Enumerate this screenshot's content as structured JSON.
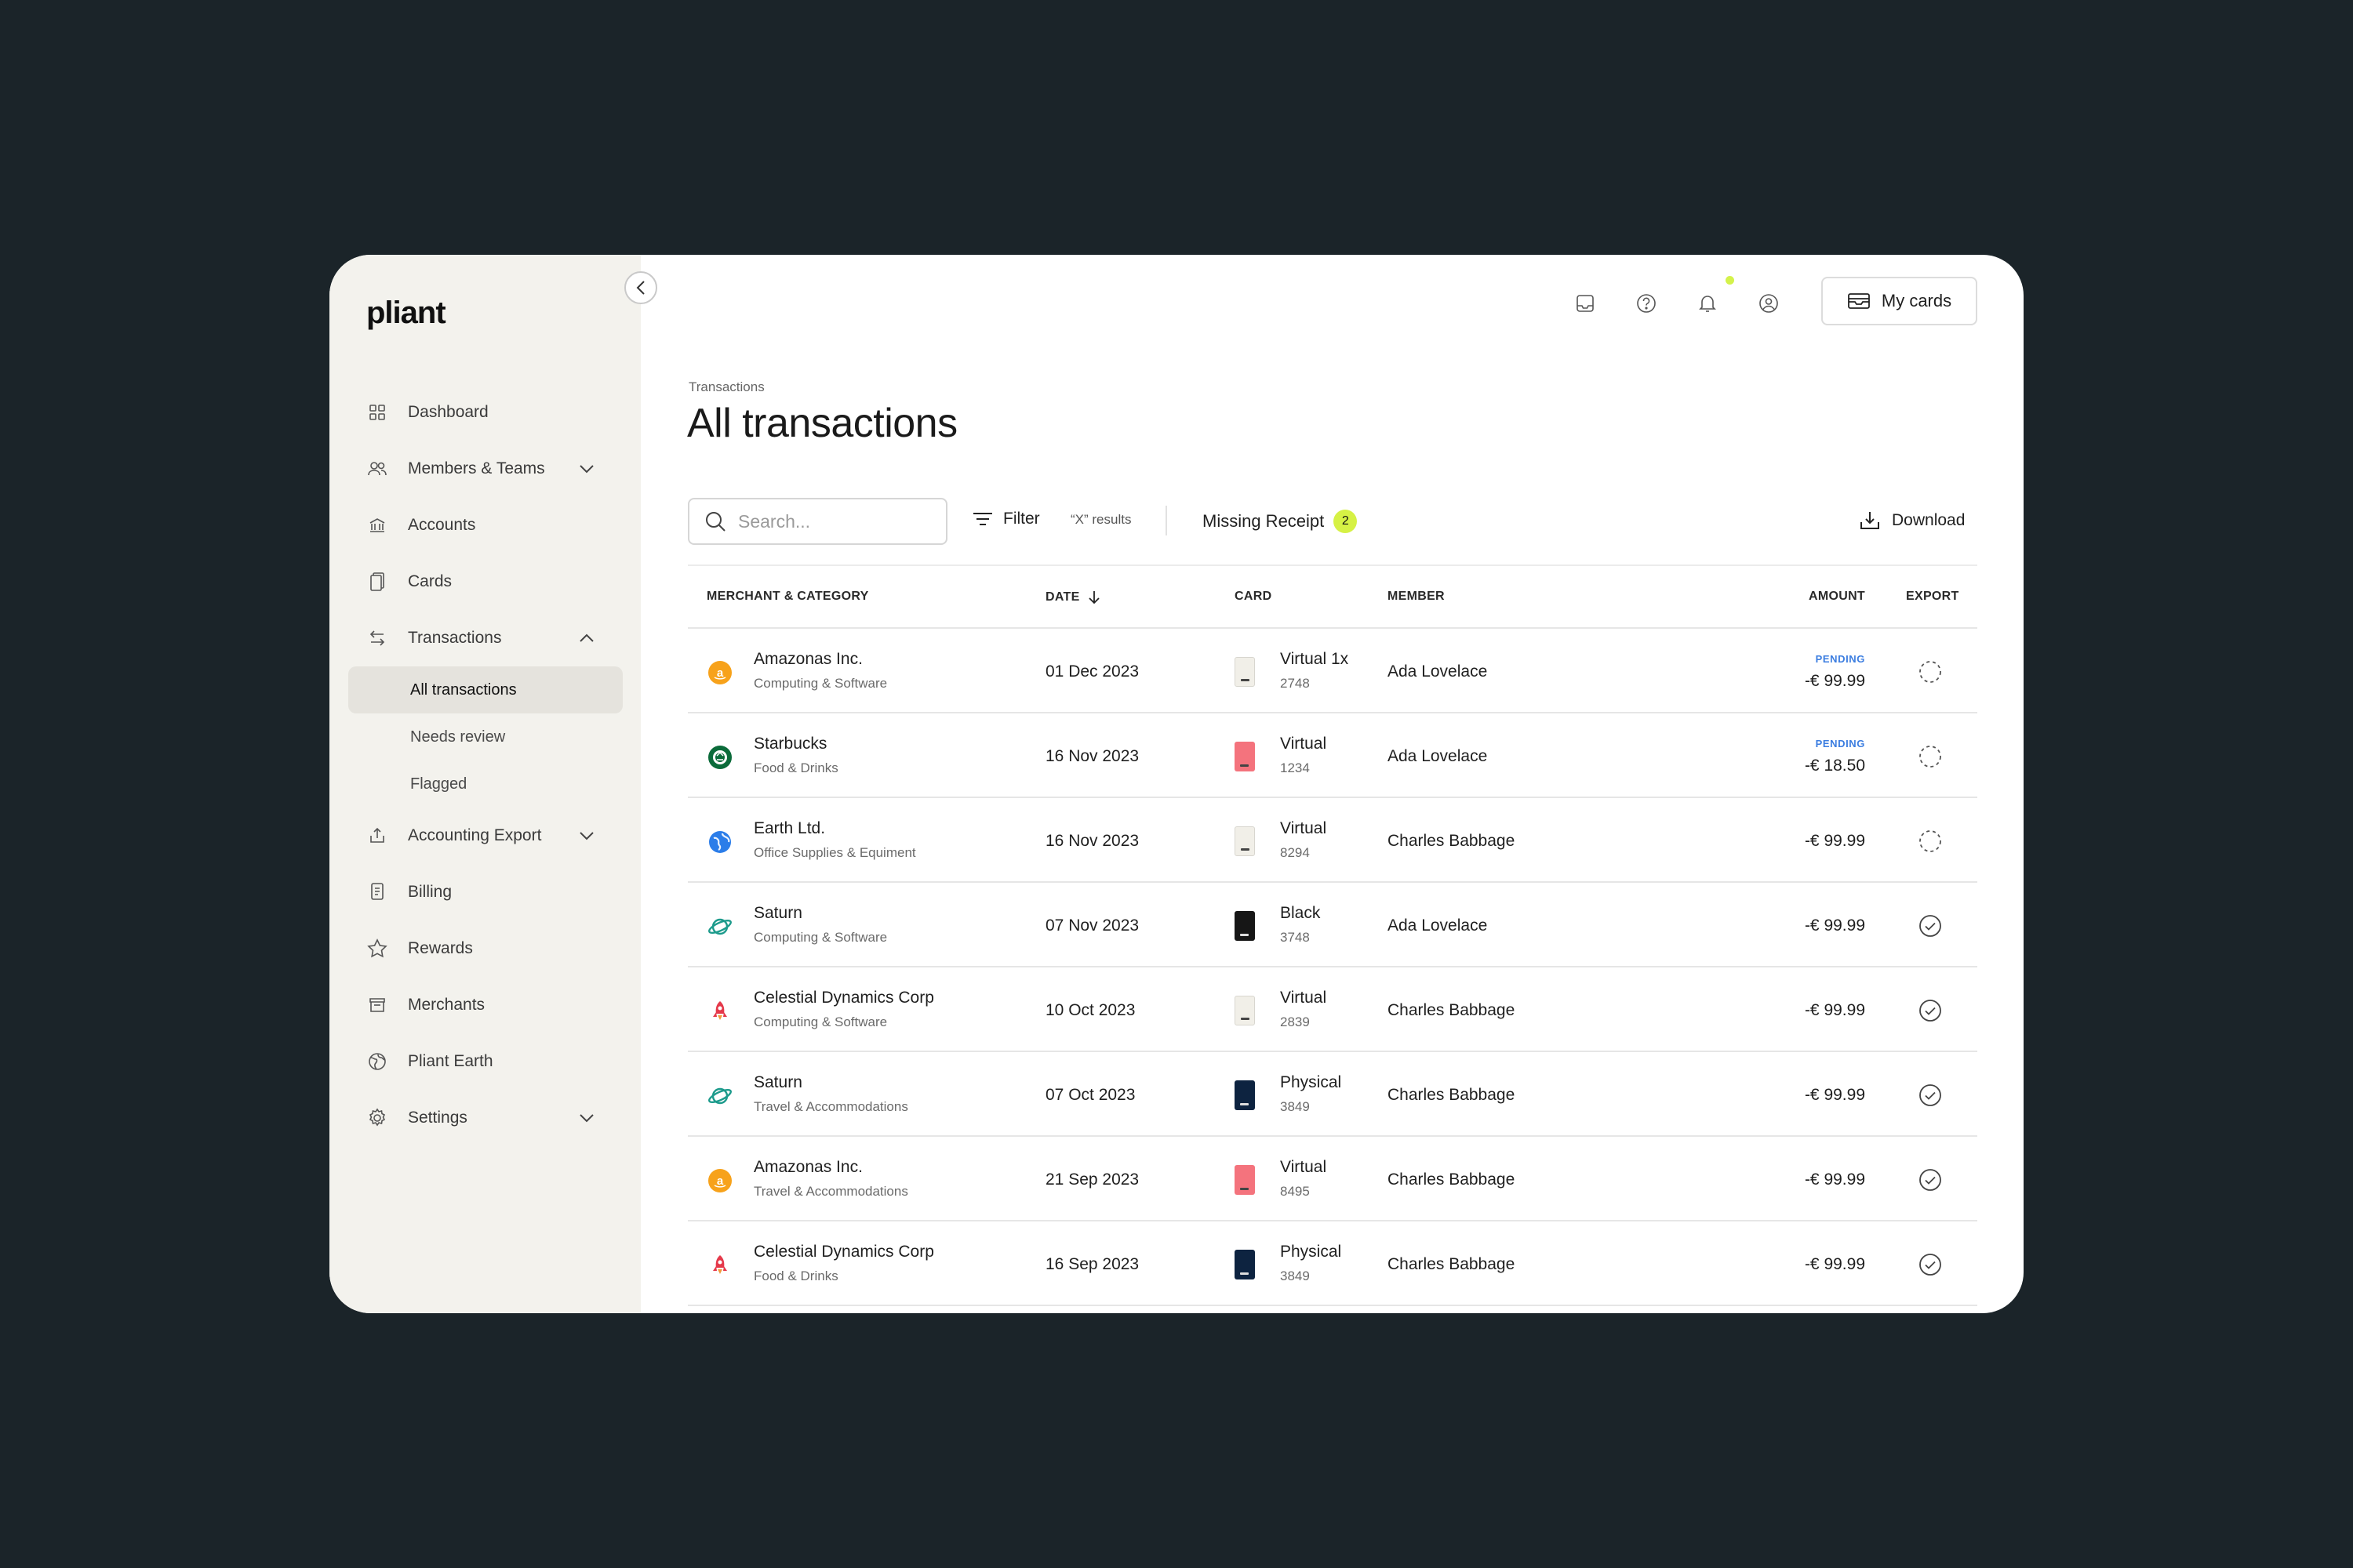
{
  "brand": {
    "logo": "pliant",
    "accent": "#d6f145",
    "sidebar_bg": "#f3f2ed",
    "page_bg": "#1b2429"
  },
  "sidebar": {
    "items": [
      {
        "label": "Dashboard",
        "icon": "dashboard-icon"
      },
      {
        "label": "Members & Teams",
        "icon": "users-icon",
        "chevron": "down"
      },
      {
        "label": "Accounts",
        "icon": "bank-icon"
      },
      {
        "label": "Cards",
        "icon": "cards-icon"
      },
      {
        "label": "Transactions",
        "icon": "arrows-icon",
        "chevron": "up"
      },
      {
        "label": "Accounting Export",
        "icon": "export-icon",
        "chevron": "down"
      },
      {
        "label": "Billing",
        "icon": "billing-icon"
      },
      {
        "label": "Rewards",
        "icon": "star-icon"
      },
      {
        "label": "Merchants",
        "icon": "store-icon"
      },
      {
        "label": "Pliant Earth",
        "icon": "globe-icon"
      },
      {
        "label": "Settings",
        "icon": "gear-icon",
        "chevron": "down"
      }
    ],
    "sub_items": [
      {
        "label": "All transactions",
        "active": true
      },
      {
        "label": "Needs review",
        "active": false
      },
      {
        "label": "Flagged",
        "active": false
      }
    ]
  },
  "topbar": {
    "icons": [
      "inbox-icon",
      "help-icon",
      "bell-icon",
      "profile-icon"
    ],
    "my_cards_label": "My cards"
  },
  "header": {
    "breadcrumb": "Transactions",
    "title": "All transactions"
  },
  "toolbar": {
    "search_placeholder": "Search...",
    "filter_label": "Filter",
    "results_label": "“X” results",
    "missing_receipt_label": "Missing Receipt",
    "missing_receipt_count": "2",
    "download_label": "Download"
  },
  "table": {
    "columns": {
      "merchant": "MERCHANT & CATEGORY",
      "date": "DATE",
      "card": "CARD",
      "member": "MEMBER",
      "amount": "AMOUNT",
      "export": "EXPORT"
    },
    "rows": [
      {
        "merchant": "Amazonas Inc.",
        "category": "Computing & Software",
        "icon": "amazon-icon",
        "date": "01 Dec 2023",
        "card_type": "Virtual 1x",
        "card_last4": "2748",
        "card_color": "#f1efe8",
        "member": "Ada Lovelace",
        "status": "PENDING",
        "amount": "-€ 99.99",
        "exported": false
      },
      {
        "merchant": "Starbucks",
        "category": "Food & Drinks",
        "icon": "starbucks-icon",
        "date": "16 Nov 2023",
        "card_type": "Virtual",
        "card_last4": "1234",
        "card_color": "#f4737d",
        "member": "Ada Lovelace",
        "status": "PENDING",
        "amount": "-€ 18.50",
        "exported": false
      },
      {
        "merchant": "Earth Ltd.",
        "category": "Office Supplies & Equiment",
        "icon": "earth-icon",
        "date": "16 Nov 2023",
        "card_type": "Virtual",
        "card_last4": "8294",
        "card_color": "#f1efe8",
        "member": "Charles Babbage",
        "status": "",
        "amount": "-€ 99.99",
        "exported": false
      },
      {
        "merchant": "Saturn",
        "category": "Computing & Software",
        "icon": "saturn-icon",
        "date": "07 Nov 2023",
        "card_type": "Black",
        "card_last4": "3748",
        "card_color": "#161616",
        "member": "Ada Lovelace",
        "status": "",
        "amount": "-€ 99.99",
        "exported": true
      },
      {
        "merchant": "Celestial Dynamics Corp",
        "category": "Computing & Software",
        "icon": "rocket-icon",
        "date": "10 Oct 2023",
        "card_type": "Virtual",
        "card_last4": "2839",
        "card_color": "#f1efe8",
        "member": "Charles Babbage",
        "status": "",
        "amount": "-€ 99.99",
        "exported": true
      },
      {
        "merchant": "Saturn",
        "category": "Travel & Accommodations",
        "icon": "saturn-icon",
        "date": "07 Oct 2023",
        "card_type": "Physical",
        "card_last4": "3849",
        "card_color": "#0d2340",
        "member": "Charles Babbage",
        "status": "",
        "amount": "-€ 99.99",
        "exported": true
      },
      {
        "merchant": "Amazonas Inc.",
        "category": "Travel & Accommodations",
        "icon": "amazon-icon",
        "date": "21 Sep 2023",
        "card_type": "Virtual",
        "card_last4": "8495",
        "card_color": "#f4737d",
        "member": "Charles Babbage",
        "status": "",
        "amount": "-€ 99.99",
        "exported": true
      },
      {
        "merchant": "Celestial Dynamics Corp",
        "category": "Food & Drinks",
        "icon": "rocket-icon",
        "date": "16 Sep 2023",
        "card_type": "Physical",
        "card_last4": "3849",
        "card_color": "#0d2340",
        "member": "Charles Babbage",
        "status": "",
        "amount": "-€ 99.99",
        "exported": true
      }
    ]
  }
}
